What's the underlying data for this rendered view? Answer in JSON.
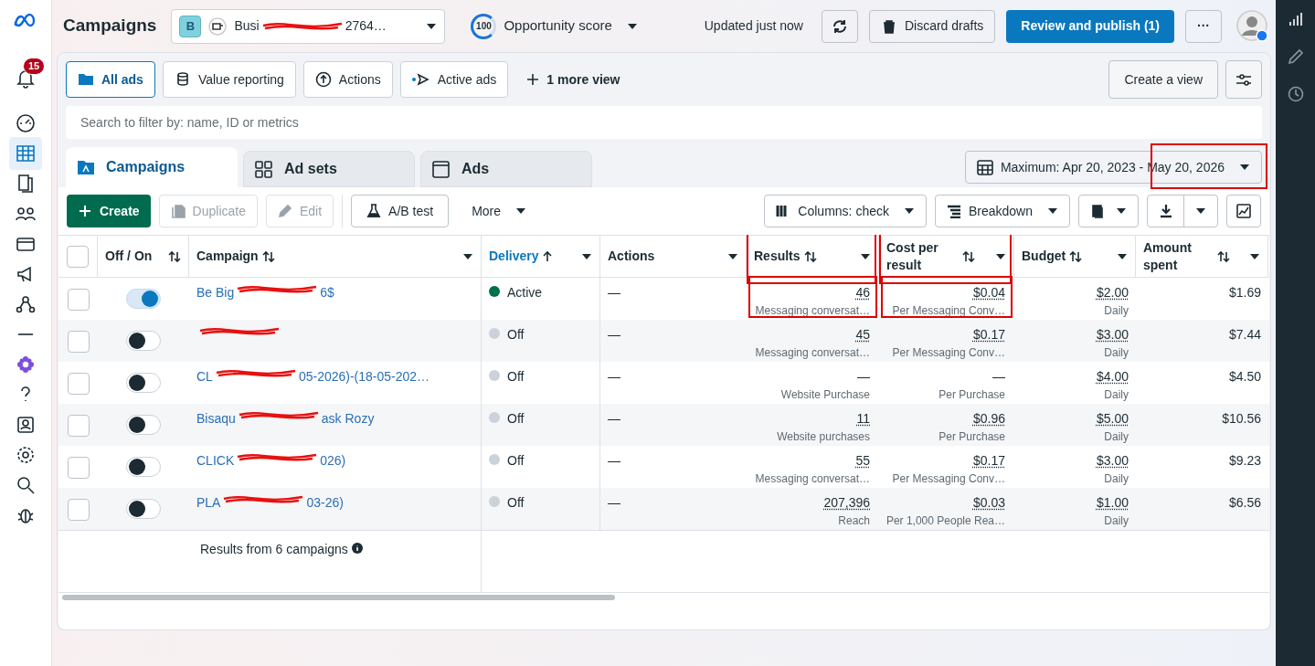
{
  "header": {
    "title": "Campaigns",
    "account": {
      "initial": "B",
      "name": [
        {
          "kind": "text",
          "text": "Busi"
        },
        {
          "kind": "scribble"
        },
        {
          "kind": "text",
          "text": "2764…"
        }
      ]
    },
    "opportunity": {
      "score": "100",
      "label": "Opportunity score"
    },
    "updated": "Updated just now",
    "discard": "Discard drafts",
    "publish": "Review and publish (1)",
    "more": "···"
  },
  "notifications": {
    "count": "15"
  },
  "views": [
    {
      "label": "All ads",
      "selected": true
    },
    {
      "label": "Value reporting",
      "selected": false
    },
    {
      "label": "Actions",
      "selected": false
    },
    {
      "label": "Active ads",
      "selected": false
    }
  ],
  "more_view": "1 more view",
  "create_view": "Create a view",
  "search": {
    "placeholder": "Search to filter by: name, ID or metrics"
  },
  "tabs": [
    {
      "label": "Campaigns",
      "selected": true
    },
    {
      "label": "Ad sets",
      "selected": false
    },
    {
      "label": "Ads",
      "selected": false
    }
  ],
  "date_range": {
    "label": "Maximum: Apr 20, 2023 - May 20, 2026",
    "highlighted": true
  },
  "toolbar": {
    "create": "Create",
    "duplicate": "Duplicate",
    "edit": "Edit",
    "ab_test": "A/B test",
    "more": "More",
    "columns": "Columns: check",
    "breakdown": "Breakdown"
  },
  "table": {
    "select_all": {
      "checked": false
    },
    "columns": [
      {
        "label": "Off / On"
      },
      {
        "label": "Campaign"
      },
      {
        "label": "Delivery"
      },
      {
        "label": "Actions"
      },
      {
        "label": "Results",
        "highlighted": true
      },
      {
        "label": "Cost per result",
        "highlighted": true
      },
      {
        "label": "Budget"
      },
      {
        "label": "Amount spent"
      }
    ],
    "rows": [
      {
        "checked": false,
        "on": true,
        "name": [
          {
            "kind": "text",
            "text": "Be Big"
          },
          {
            "kind": "scribble"
          },
          {
            "kind": "text",
            "text": "6$"
          }
        ],
        "delivery": "Active",
        "color": "#00704a",
        "actions": "—",
        "results": "46",
        "results_label": "Messaging conversat…",
        "cost": "$0.04",
        "cost_label": "Per Messaging Conv…",
        "highlighted": true,
        "budget": "$2.00",
        "budget_label": "Daily",
        "spent": "$1.69"
      },
      {
        "checked": false,
        "on": false,
        "name": [
          {
            "kind": "scribble"
          }
        ],
        "delivery": "Off",
        "color": "#cbd2d9",
        "actions": "—",
        "results": "45",
        "results_label": "Messaging conversat…",
        "cost": "$0.17",
        "cost_label": "Per Messaging Conv…",
        "budget": "$3.00",
        "budget_label": "Daily",
        "spent": "$7.44"
      },
      {
        "checked": false,
        "on": false,
        "name": [
          {
            "kind": "text",
            "text": "CL"
          },
          {
            "kind": "scribble"
          },
          {
            "kind": "text",
            "text": "05-2026)-(18-05-202…"
          }
        ],
        "delivery": "Off",
        "color": "#cbd2d9",
        "actions": "—",
        "results": "—",
        "results_label": "Website Purchase",
        "cost": "—",
        "cost_label": "Per Purchase",
        "budget": "$4.00",
        "budget_label": "Daily",
        "spent": "$4.50"
      },
      {
        "checked": false,
        "on": false,
        "name": [
          {
            "kind": "text",
            "text": "Bisaqu"
          },
          {
            "kind": "scribble"
          },
          {
            "kind": "text",
            "text": "ask Rozy"
          }
        ],
        "delivery": "Off",
        "color": "#cbd2d9",
        "actions": "—",
        "results": "11",
        "results_label": "Website purchases",
        "cost": "$0.96",
        "cost_label": "Per Purchase",
        "budget": "$5.00",
        "budget_label": "Daily",
        "spent": "$10.56"
      },
      {
        "checked": false,
        "on": false,
        "name": [
          {
            "kind": "text",
            "text": "CLICK"
          },
          {
            "kind": "scribble"
          },
          {
            "kind": "text",
            "text": "026)"
          }
        ],
        "delivery": "Off",
        "color": "#cbd2d9",
        "actions": "—",
        "results": "55",
        "results_label": "Messaging conversat…",
        "cost": "$0.17",
        "cost_label": "Per Messaging Conv…",
        "budget": "$3.00",
        "budget_label": "Daily",
        "spent": "$9.23"
      },
      {
        "checked": false,
        "on": false,
        "name": [
          {
            "kind": "text",
            "text": "PLA"
          },
          {
            "kind": "scribble"
          },
          {
            "kind": "text",
            "text": "03-26)"
          }
        ],
        "delivery": "Off",
        "color": "#cbd2d9",
        "actions": "—",
        "results": "207,396",
        "results_label": "Reach",
        "cost": "$0.03",
        "cost_label": "Per 1,000 People Rea…",
        "budget": "$1.00",
        "budget_label": "Daily",
        "spent": "$6.56"
      }
    ],
    "footer": "Results from 6 campaigns"
  }
}
